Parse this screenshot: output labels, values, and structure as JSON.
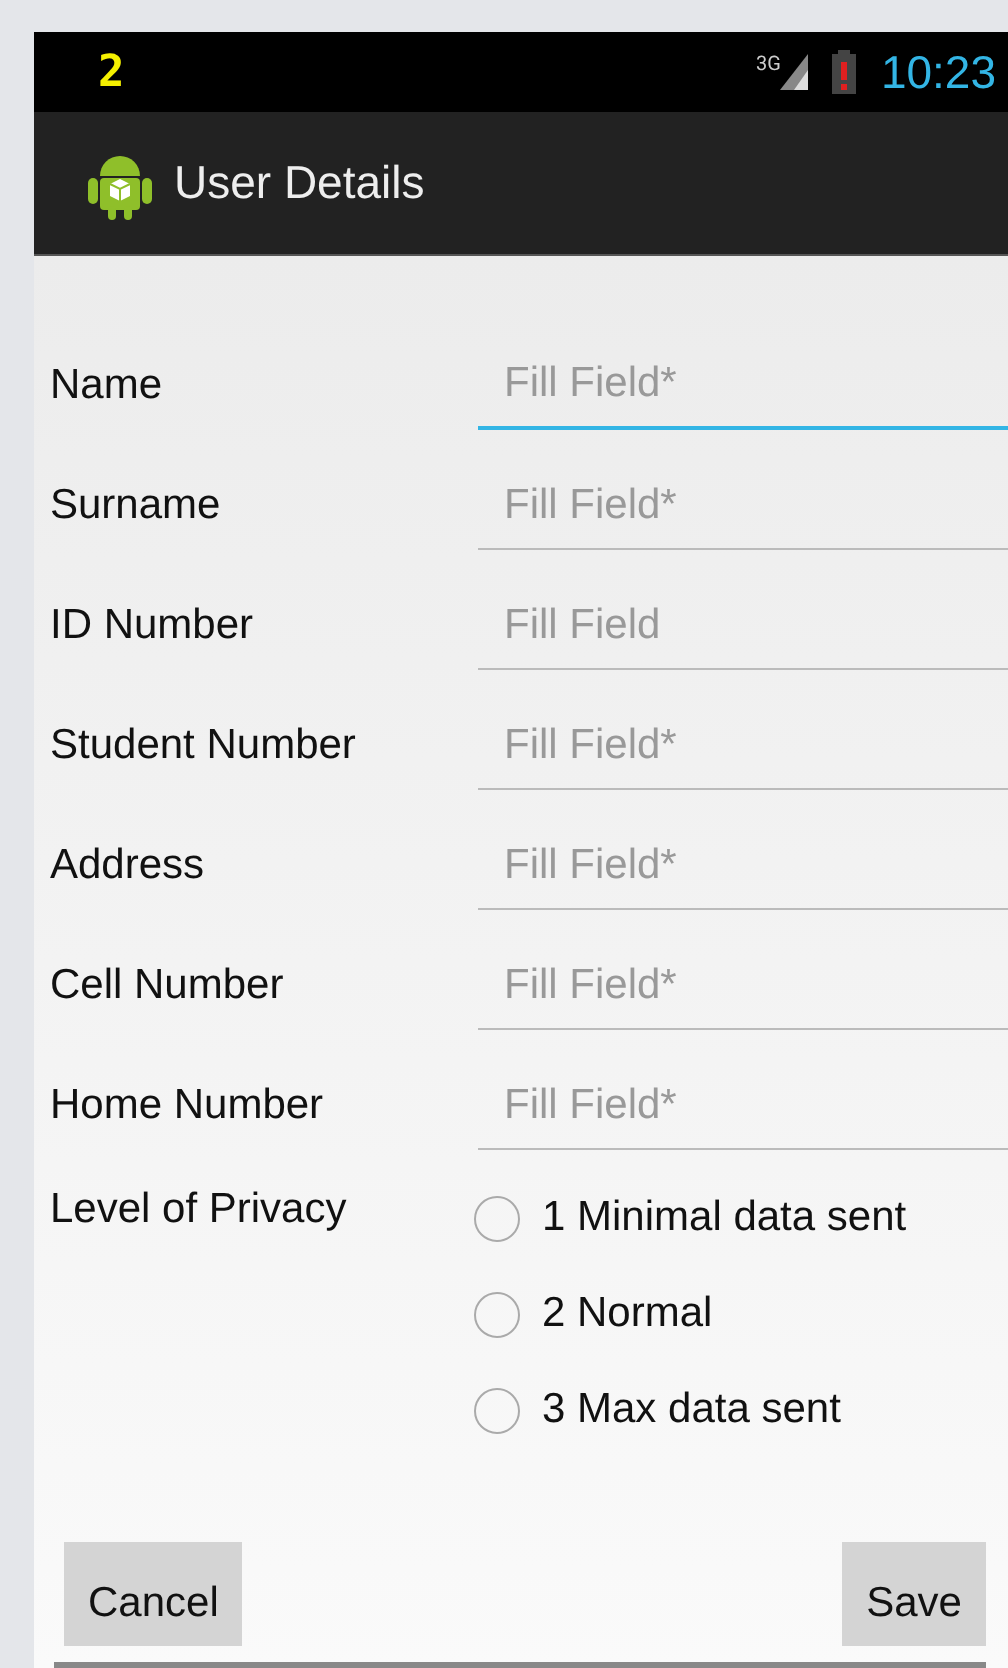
{
  "status_bar": {
    "notification": "2",
    "network": "3G",
    "time": "10:23"
  },
  "action_bar": {
    "title": "User Details"
  },
  "fields": [
    {
      "label": "Name",
      "placeholder": "Fill Field*",
      "focused": true
    },
    {
      "label": "Surname",
      "placeholder": "Fill Field*",
      "focused": false
    },
    {
      "label": "ID Number",
      "placeholder": "Fill Field",
      "focused": false
    },
    {
      "label": "Student Number",
      "placeholder": "Fill Field*",
      "focused": false
    },
    {
      "label": "Address",
      "placeholder": "Fill Field*",
      "focused": false
    },
    {
      "label": "Cell Number",
      "placeholder": "Fill Field*",
      "focused": false
    },
    {
      "label": "Home Number",
      "placeholder": "Fill Field*",
      "focused": false
    }
  ],
  "privacy": {
    "label": "Level of Privacy",
    "options": [
      {
        "label": "1 Minimal data sent",
        "selected": false
      },
      {
        "label": "2 Normal",
        "selected": false
      },
      {
        "label": "3 Max data sent",
        "selected": false
      }
    ]
  },
  "buttons": [
    {
      "label": "Cancel"
    },
    {
      "label": "Save"
    }
  ]
}
